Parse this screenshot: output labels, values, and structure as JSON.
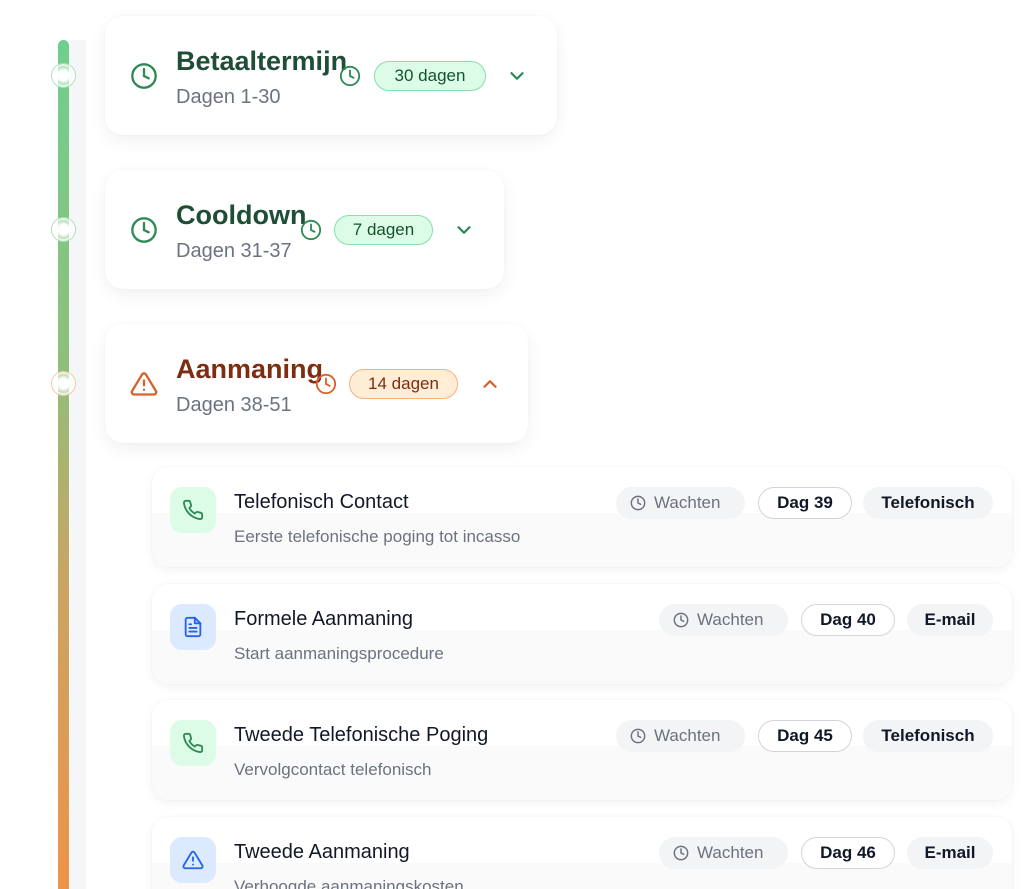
{
  "colors": {
    "green_accent": "#2f8a55",
    "orange_accent": "#d9622b",
    "blue_accent": "#2563eb"
  },
  "phases": [
    {
      "title": "Betaaltermijn",
      "subtitle": "Dagen 1-30",
      "duration": "30 dagen",
      "icon": "clock-icon",
      "status": "expanded-false"
    },
    {
      "title": "Cooldown",
      "subtitle": "Dagen 31-37",
      "duration": "7 dagen",
      "icon": "clock-icon",
      "status": "expanded-false"
    },
    {
      "title": "Aanmaning",
      "subtitle": "Dagen 38-51",
      "duration": "14 dagen",
      "icon": "warning-icon",
      "status": "expanded-true"
    }
  ],
  "steps": [
    {
      "title": "Telefonisch Contact",
      "description": "Eerste telefonische poging tot incasso",
      "status": "Wachten",
      "day": "Dag 39",
      "type": "Telefonisch",
      "icon": "phone-icon"
    },
    {
      "title": "Formele Aanmaning",
      "description": "Start aanmaningsprocedure",
      "status": "Wachten",
      "day": "Dag 40",
      "type": "E-mail",
      "icon": "document-icon"
    },
    {
      "title": "Tweede Telefonische Poging",
      "description": "Vervolgcontact telefonisch",
      "status": "Wachten",
      "day": "Dag 45",
      "type": "Telefonisch",
      "icon": "phone-icon"
    },
    {
      "title": "Tweede Aanmaning",
      "description": "Verhoogde aanmaningskosten",
      "status": "Wachten",
      "day": "Dag 46",
      "type": "E-mail",
      "icon": "warning-icon"
    }
  ]
}
